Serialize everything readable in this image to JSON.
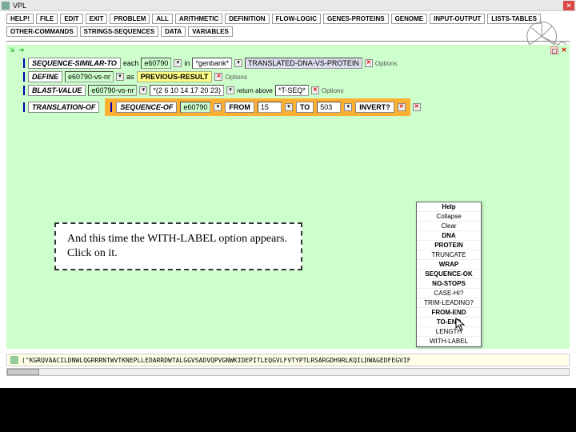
{
  "window": {
    "title": "VPL"
  },
  "toolbar": {
    "row1": [
      "HELP!",
      "FILE",
      "EDIT",
      "EXIT",
      "PROBLEM",
      "ALL",
      "ARITHMETIC",
      "DEFINITION",
      "FLOW-LOGIC",
      "GENES-PROTEINS",
      "GENOME",
      "INPUT-OUTPUT",
      "LISTS-TABLES"
    ],
    "row2": [
      "OTHER-COMMANDS",
      "STRINGS-SEQUENCES",
      "DATA",
      "VARIABLES"
    ]
  },
  "rows": {
    "seq_similar": {
      "label": "SEQUENCE-SIMILAR-TO",
      "each": "each",
      "val": "e60790",
      "in": "in",
      "db": "*genbank*",
      "result": "TRANSLATED-DNA-VS-PROTEIN",
      "options": "Options"
    },
    "define": {
      "label": "DEFINE",
      "var": "e60790-vs-nr",
      "prev": "PREVIOUS-RESULT",
      "options": "Options"
    },
    "blast": {
      "label": "BLAST-VALUE",
      "var": "e60790-vs-nr",
      "expr": "*(2 6 10 14 17 20 23)",
      "return": "return above",
      "tseq": "*T-SEQ*",
      "options": "Options"
    },
    "translation": {
      "label": "TRANSLATION-OF",
      "seq_of": "SEQUENCE-OF",
      "val": "e60790",
      "from_lbl": "FROM",
      "from": "15",
      "to_lbl": "TO",
      "to": "503",
      "invert": "INVERT?"
    }
  },
  "menu": {
    "items": [
      "Help",
      "Collapse",
      "Clear",
      "DNA",
      "PROTEIN",
      "TRUNCATE",
      "WRAP",
      "SEQUENCE-OK",
      "NO-STOPS",
      "CASE-HI?",
      "TRIM-LEADING?",
      "FROM-END",
      "TO-END",
      "LENGTH",
      "WITH-LABEL"
    ]
  },
  "callout": "And this time the WITH-LABEL option appears. Click on it.",
  "output": "(\"KGRQVAACILDNWLQGRRRNTWVTKNEPLLEDARRDWTALGGVSADVQPVGNWKIDEPITLEQGVLFVTYPTLRSARGDH9RLKQILDWAGEDFEGVIF"
}
